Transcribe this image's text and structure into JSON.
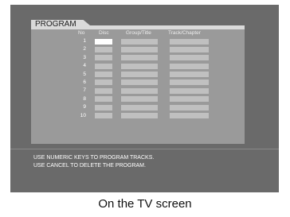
{
  "tab_title": "PROGRAM",
  "columns": {
    "no": "No",
    "disc": "Disc",
    "group": "Group/Title",
    "track": "Track/Chapter"
  },
  "rows": [
    "1",
    "2",
    "3",
    "4",
    "5",
    "6",
    "7",
    "8",
    "9",
    "10"
  ],
  "messages": [
    "USE NUMERIC KEYS TO PROGRAM TRACKS.",
    "USE CANCEL TO DELETE THE PROGRAM."
  ],
  "caption": "On the TV screen"
}
